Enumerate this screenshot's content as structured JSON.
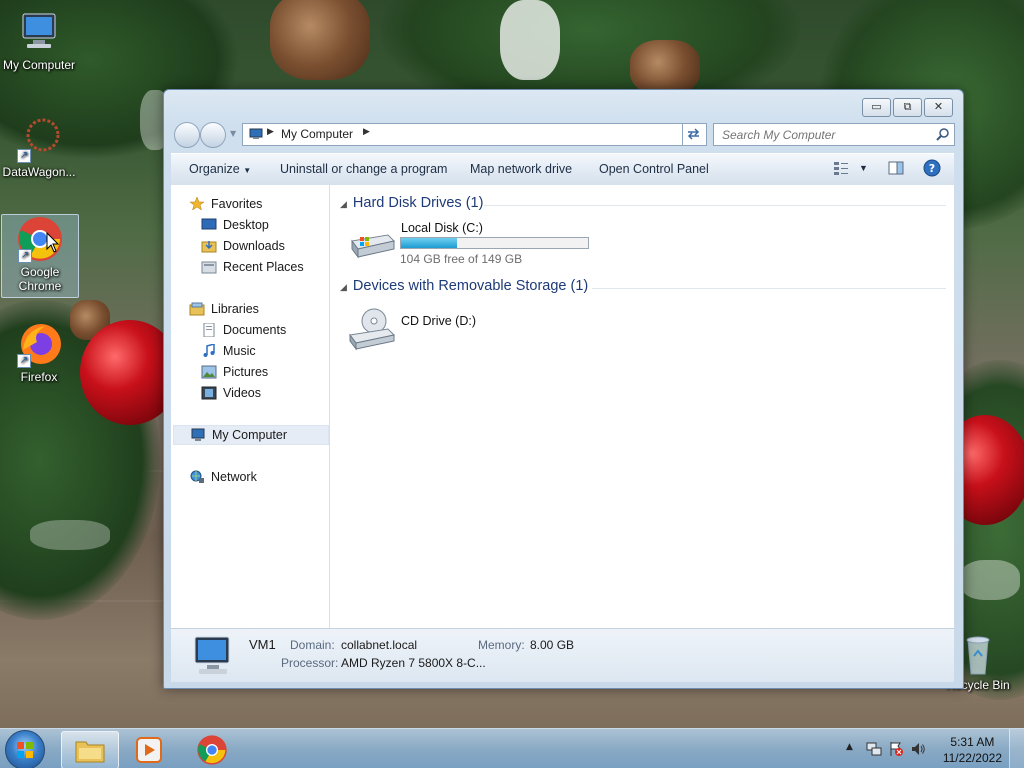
{
  "desktop": {
    "icons": [
      {
        "label": "My Computer"
      },
      {
        "label": "DataWagon..."
      },
      {
        "label": "Google Chrome"
      },
      {
        "label": "Firefox"
      },
      {
        "label": "Recycle Bin"
      }
    ]
  },
  "window": {
    "address": {
      "location": "My Computer"
    },
    "search": {
      "placeholder": "Search My Computer"
    },
    "toolbar": {
      "organize": "Organize",
      "uninstall": "Uninstall or change a program",
      "map_drive": "Map network drive",
      "control_panel": "Open Control Panel"
    },
    "nav": {
      "favorites": "Favorites",
      "desktop": "Desktop",
      "downloads": "Downloads",
      "recent": "Recent Places",
      "libraries": "Libraries",
      "documents": "Documents",
      "music": "Music",
      "pictures": "Pictures",
      "videos": "Videos",
      "computer": "My Computer",
      "network": "Network"
    },
    "groups": {
      "hdd_title": "Hard Disk Drives (1)",
      "removable_title": "Devices with Removable Storage (1)"
    },
    "drives": {
      "c": {
        "name": "Local Disk (C:)",
        "free_text": "104 GB free of 149 GB",
        "used_fraction": 0.3
      },
      "d": {
        "name": "CD Drive (D:)"
      }
    },
    "details": {
      "computer_name": "VM1",
      "domain_label": "Domain:",
      "domain_value": "collabnet.local",
      "memory_label": "Memory:",
      "memory_value": "8.00 GB",
      "processor_label": "Processor:",
      "processor_value": "AMD Ryzen 7 5800X 8-C..."
    }
  },
  "taskbar": {
    "time": "5:31 AM",
    "date": "11/22/2022"
  },
  "colors": {
    "group_header": "#1e3a78",
    "disk_fill": "#1d9bd2"
  }
}
